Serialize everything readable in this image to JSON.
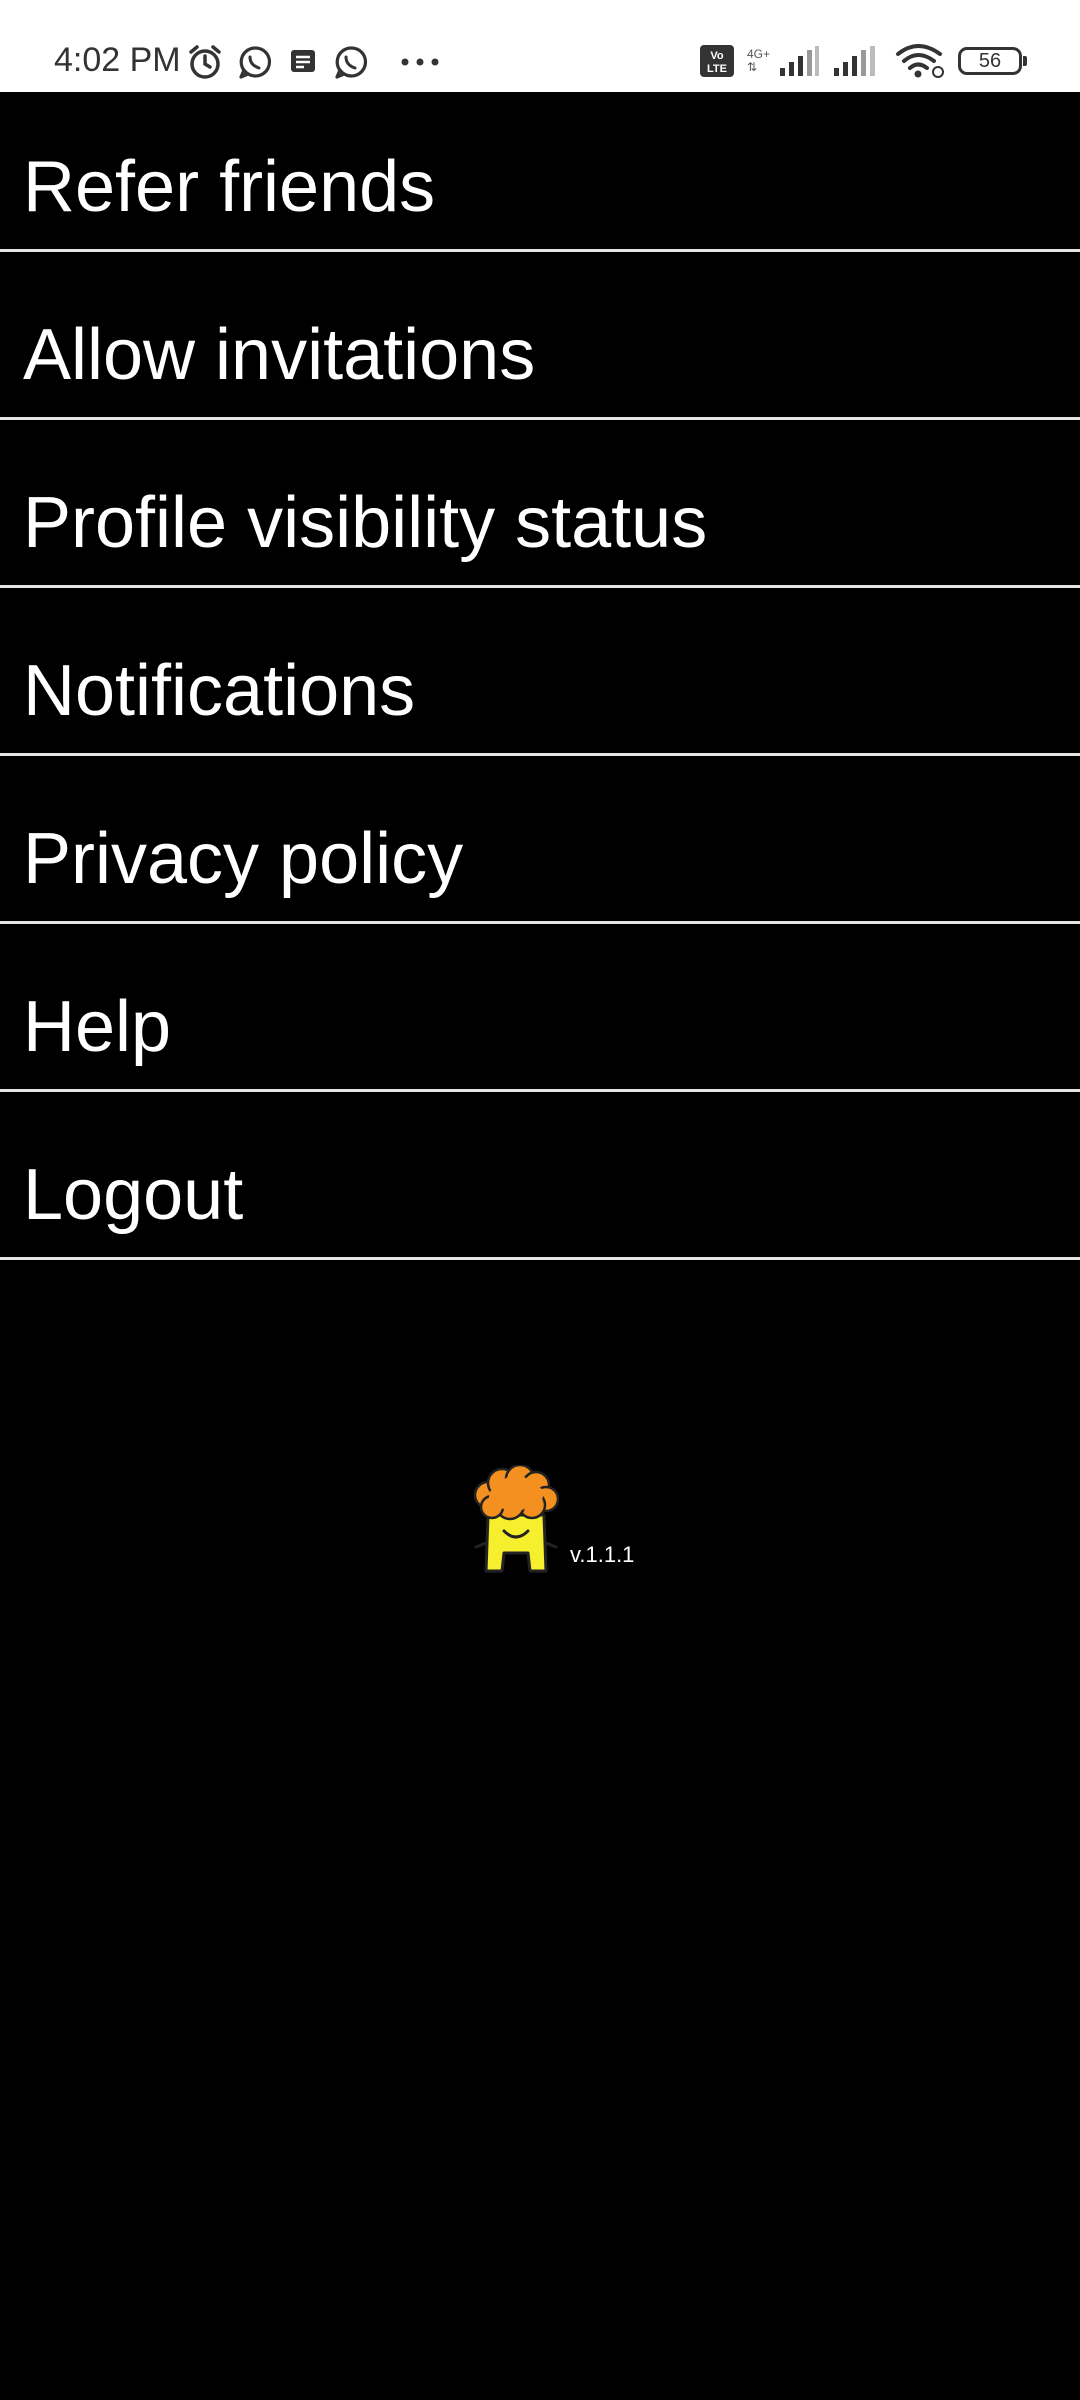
{
  "status_bar": {
    "time": "4:02 PM",
    "left_icons": [
      "alarm-icon",
      "whatsapp-icon",
      "message-icon",
      "whatsapp-icon",
      "more-icon"
    ],
    "network_tag_top": "4G+",
    "volte_label": "Vo LTE",
    "battery_level": "56"
  },
  "menu": {
    "items": [
      {
        "label": "Refer friends"
      },
      {
        "label": "Allow invitations"
      },
      {
        "label": "Profile visibility status"
      },
      {
        "label": "Notifications"
      },
      {
        "label": "Privacy policy"
      },
      {
        "label": "Help"
      },
      {
        "label": "Logout"
      }
    ]
  },
  "footer": {
    "version": "v.1.1.1"
  },
  "colors": {
    "background": "#000000",
    "status_bar": "#ffffff",
    "text": "#ffffff",
    "divider": "#e6e6e6",
    "logo_orange": "#f3901f",
    "logo_yellow": "#f6ef2e"
  }
}
